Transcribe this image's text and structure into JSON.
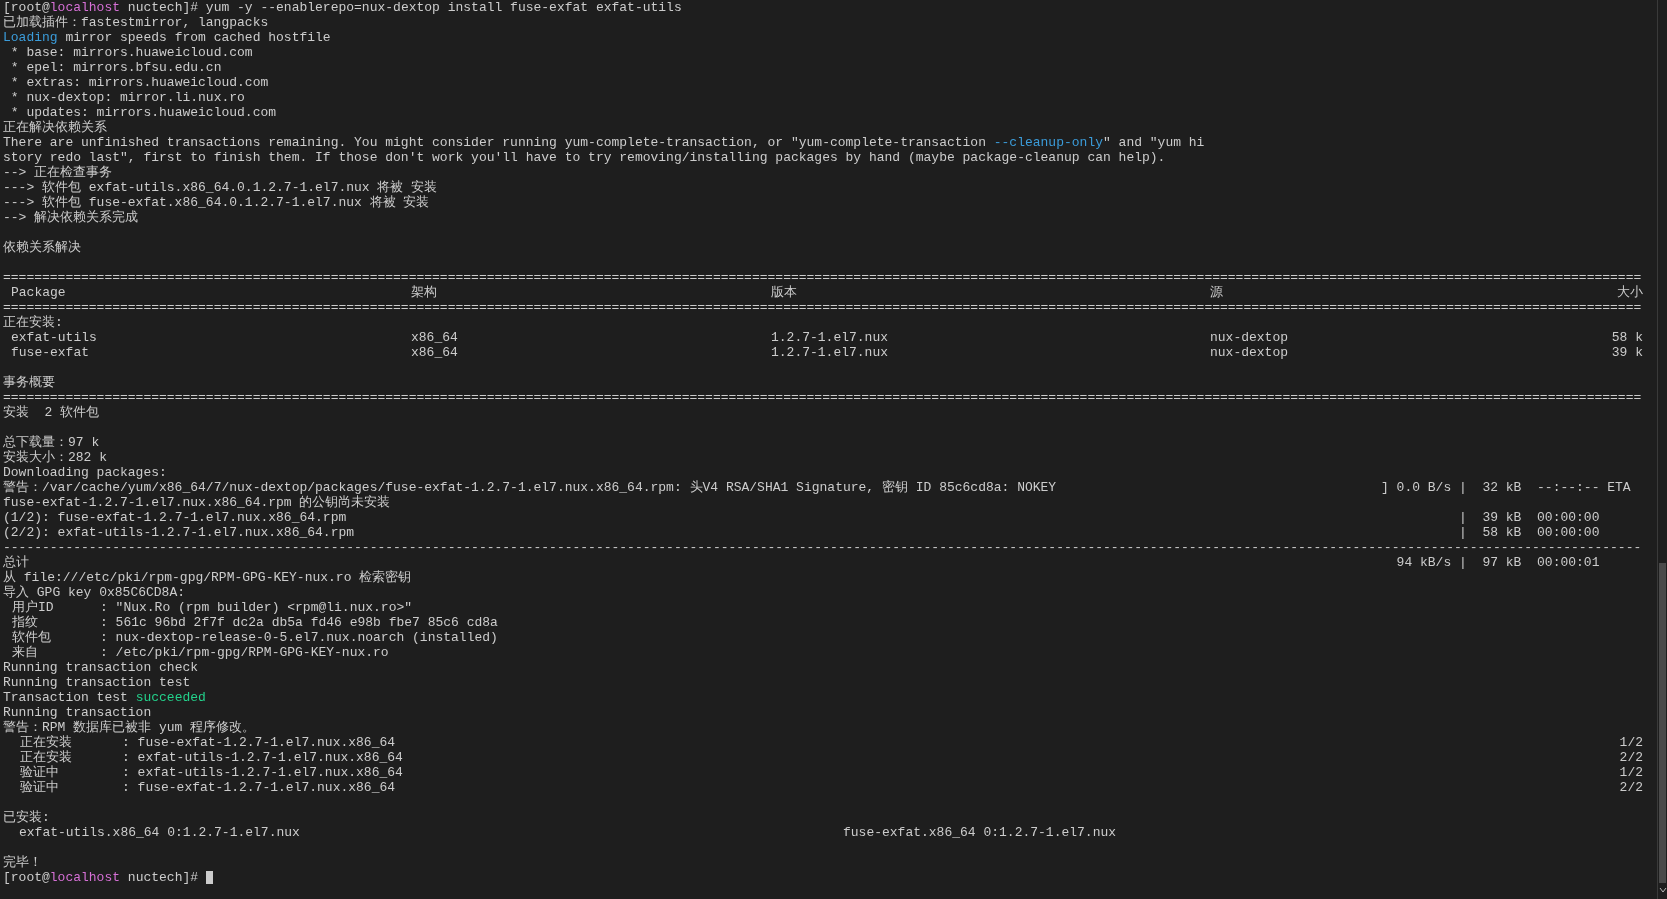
{
  "terminal": {
    "lines": [
      {
        "kind": "text",
        "segments": [
          {
            "text": "[root@"
          },
          {
            "text": "localhost",
            "color": "#d670d6"
          },
          {
            "text": " nuctech]# yum -y --enablerepo=nux-dextop install fuse-exfat exfat-utils"
          }
        ]
      },
      {
        "kind": "text",
        "segments": [
          {
            "text": "已加载插件：fastestmirror, langpacks"
          }
        ]
      },
      {
        "kind": "text",
        "segments": [
          {
            "text": "Loading",
            "color": "#3b9cda"
          },
          {
            "text": " mirror speeds from cached hostfile"
          }
        ]
      },
      {
        "kind": "text",
        "segments": [
          {
            "text": " * base: mirrors.huaweicloud.com"
          }
        ]
      },
      {
        "kind": "text",
        "segments": [
          {
            "text": " * epel: mirrors.bfsu.edu.cn"
          }
        ]
      },
      {
        "kind": "text",
        "segments": [
          {
            "text": " * extras: mirrors.huaweicloud.com"
          }
        ]
      },
      {
        "kind": "text",
        "segments": [
          {
            "text": " * nux-dextop: mirror.li.nux.ro"
          }
        ]
      },
      {
        "kind": "text",
        "segments": [
          {
            "text": " * updates: mirrors.huaweicloud.com"
          }
        ]
      },
      {
        "kind": "text",
        "segments": [
          {
            "text": "正在解决依赖关系"
          }
        ]
      },
      {
        "kind": "text",
        "segments": [
          {
            "text": "There are unfinished transactions remaining. You might consider running yum-complete-transaction, or \"yum-complete-transaction "
          },
          {
            "text": "--cleanup-only",
            "color": "#3b9cda"
          },
          {
            "text": "\" and \"yum hi"
          }
        ]
      },
      {
        "kind": "text",
        "segments": [
          {
            "text": "story redo last\", first to finish them. If those don't work you'll have to try removing/installing packages by hand (maybe package-cleanup can help)."
          }
        ]
      },
      {
        "kind": "text",
        "segments": [
          {
            "text": "--> 正在检查事务"
          }
        ]
      },
      {
        "kind": "text",
        "segments": [
          {
            "text": "---> 软件包 exfat-utils.x86_64.0.1.2.7-1.el7.nux 将被 安装"
          }
        ]
      },
      {
        "kind": "text",
        "segments": [
          {
            "text": "---> 软件包 fuse-exfat.x86_64.0.1.2.7-1.el7.nux 将被 安装"
          }
        ]
      },
      {
        "kind": "text",
        "segments": [
          {
            "text": "--> 解决依赖关系完成"
          }
        ]
      },
      {
        "kind": "blank"
      },
      {
        "kind": "text",
        "segments": [
          {
            "text": "依赖关系解决"
          }
        ]
      },
      {
        "kind": "blank"
      },
      {
        "kind": "text",
        "segments": [
          {
            "text": "=================================================================================================================================================================================================================="
          }
        ]
      },
      {
        "kind": "table_row",
        "cells": [
          "Package",
          "架构",
          "版本",
          "源",
          "大小"
        ]
      },
      {
        "kind": "text",
        "segments": [
          {
            "text": "=================================================================================================================================================================================================================="
          }
        ]
      },
      {
        "kind": "text",
        "segments": [
          {
            "text": "正在安装:"
          }
        ]
      },
      {
        "kind": "table_row",
        "cells": [
          "exfat-utils",
          "x86_64",
          "1.2.7-1.el7.nux",
          "nux-dextop",
          "58 k"
        ]
      },
      {
        "kind": "table_row",
        "cells": [
          "fuse-exfat",
          "x86_64",
          "1.2.7-1.el7.nux",
          "nux-dextop",
          "39 k"
        ]
      },
      {
        "kind": "blank"
      },
      {
        "kind": "text",
        "segments": [
          {
            "text": "事务概要"
          }
        ]
      },
      {
        "kind": "text",
        "segments": [
          {
            "text": "=================================================================================================================================================================================================================="
          }
        ]
      },
      {
        "kind": "text",
        "segments": [
          {
            "text": "安装  2 软件包"
          }
        ]
      },
      {
        "kind": "blank"
      },
      {
        "kind": "text",
        "segments": [
          {
            "text": "总下载量：97 k"
          }
        ]
      },
      {
        "kind": "text",
        "segments": [
          {
            "text": "安装大小：282 k"
          }
        ]
      },
      {
        "kind": "text",
        "segments": [
          {
            "text": "Downloading packages:"
          }
        ]
      },
      {
        "kind": "split",
        "left": "警告：/var/cache/yum/x86_64/7/nux-dextop/packages/fuse-exfat-1.2.7-1.el7.nux.x86_64.rpm: 头V4 RSA/SHA1 Signature, 密钥 ID 85c6cd8a: NOKEY",
        "right": "] 0.0 B/s |  32 kB  --:--:-- ETA"
      },
      {
        "kind": "text",
        "segments": [
          {
            "text": "fuse-exfat-1.2.7-1.el7.nux.x86_64.rpm 的公钥尚未安装"
          }
        ]
      },
      {
        "kind": "split",
        "left": "(1/2): fuse-exfat-1.2.7-1.el7.nux.x86_64.rpm",
        "right": "          |  39 kB  00:00:00"
      },
      {
        "kind": "split",
        "left": "(2/2): exfat-utils-1.2.7-1.el7.nux.x86_64.rpm",
        "right": "          |  58 kB  00:00:00"
      },
      {
        "kind": "text",
        "segments": [
          {
            "text": "------------------------------------------------------------------------------------------------------------------------------------------------------------------------------------------------------------------"
          }
        ]
      },
      {
        "kind": "split",
        "left": "总计",
        "right": "  94 kB/s |  97 kB  00:00:01"
      },
      {
        "kind": "text",
        "segments": [
          {
            "text": "从 file:///etc/pki/rpm-gpg/RPM-GPG-KEY-nux.ro 检索密钥"
          }
        ]
      },
      {
        "kind": "text",
        "segments": [
          {
            "text": "导入 GPG key 0x85C6CD8A:"
          }
        ]
      },
      {
        "kind": "field",
        "label": "用户ID",
        "value": ": \"Nux.Ro (rpm builder) <rpm@li.nux.ro>\""
      },
      {
        "kind": "field",
        "label": "指纹",
        "value": ": 561c 96bd 2f7f dc2a db5a fd46 e98b fbe7 85c6 cd8a"
      },
      {
        "kind": "field",
        "label": "软件包",
        "value": ": nux-dextop-release-0-5.el7.nux.noarch (installed)"
      },
      {
        "kind": "field",
        "label": "来自",
        "value": ": /etc/pki/rpm-gpg/RPM-GPG-KEY-nux.ro"
      },
      {
        "kind": "text",
        "segments": [
          {
            "text": "Running transaction check"
          }
        ]
      },
      {
        "kind": "text",
        "segments": [
          {
            "text": "Running transaction test"
          }
        ]
      },
      {
        "kind": "text",
        "segments": [
          {
            "text": "Transaction test "
          },
          {
            "text": "succeeded",
            "color": "#23d18b"
          }
        ]
      },
      {
        "kind": "text",
        "segments": [
          {
            "text": "Running transaction"
          }
        ]
      },
      {
        "kind": "text",
        "segments": [
          {
            "text": "警告：RPM 数据库已被非 yum 程序修改。"
          }
        ]
      },
      {
        "kind": "step",
        "label": "正在安装",
        "value": ": fuse-exfat-1.2.7-1.el7.nux.x86_64",
        "count": "1/2"
      },
      {
        "kind": "step",
        "label": "正在安装",
        "value": ": exfat-utils-1.2.7-1.el7.nux.x86_64",
        "count": "2/2"
      },
      {
        "kind": "step",
        "label": "验证中",
        "value": ": exfat-utils-1.2.7-1.el7.nux.x86_64",
        "count": "1/2"
      },
      {
        "kind": "step",
        "label": "验证中",
        "value": ": fuse-exfat-1.2.7-1.el7.nux.x86_64",
        "count": "2/2"
      },
      {
        "kind": "blank"
      },
      {
        "kind": "text",
        "segments": [
          {
            "text": "已安装:"
          }
        ]
      },
      {
        "kind": "pair",
        "items": [
          "exfat-utils.x86_64 0:1.2.7-1.el7.nux",
          "fuse-exfat.x86_64 0:1.2.7-1.el7.nux"
        ]
      },
      {
        "kind": "blank"
      },
      {
        "kind": "text",
        "segments": [
          {
            "text": "完毕！"
          }
        ]
      },
      {
        "kind": "prompt",
        "segments": [
          {
            "text": "[root@"
          },
          {
            "text": "localhost",
            "color": "#d670d6"
          },
          {
            "text": " nuctech]# "
          }
        ]
      }
    ]
  }
}
